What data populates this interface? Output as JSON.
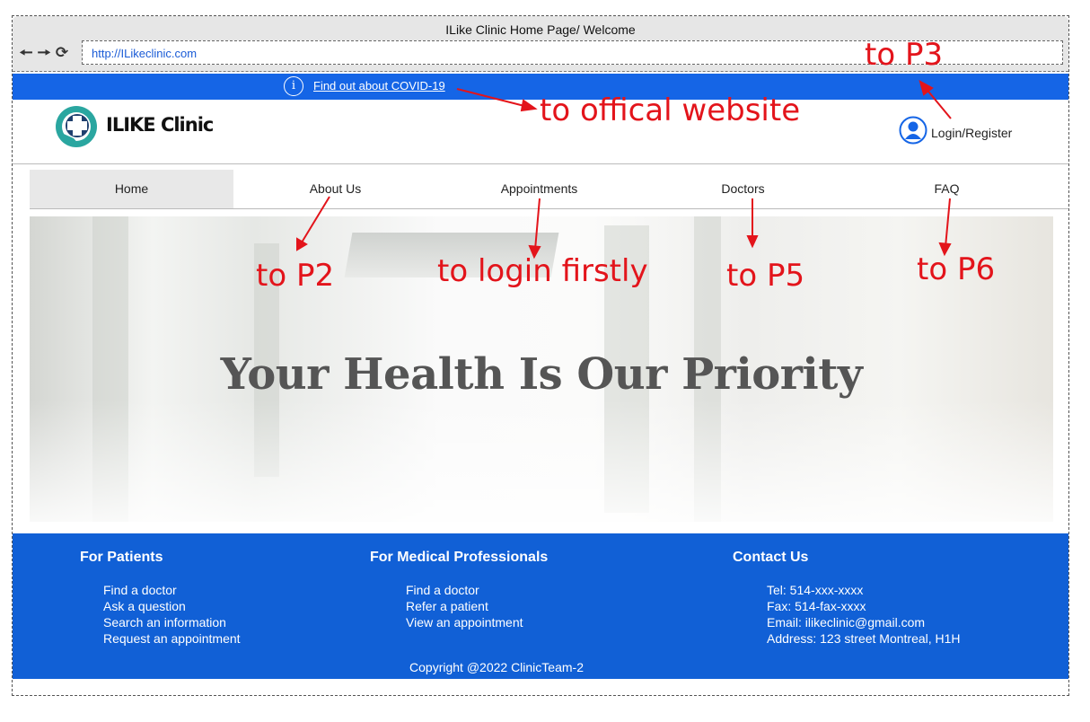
{
  "window": {
    "title": "ILike Clinic Home Page/ Welcome",
    "url": "http://ILikeclinic.com",
    "nav_icons": [
      "back-arrow-icon",
      "forward-arrow-icon",
      "refresh-icon"
    ]
  },
  "covid_bar": {
    "icon": "info-icon",
    "link": "Find out about COVID-19"
  },
  "header": {
    "logo_text": "ILIKE Clinic",
    "login": "Login/Register"
  },
  "menu": {
    "items": [
      "Home",
      "About Us",
      "Appointments",
      "Doctors",
      "FAQ"
    ],
    "active": "Home"
  },
  "hero": {
    "title": "Your Health Is Our Priority"
  },
  "footer": {
    "patients": {
      "heading": "For Patients",
      "links": [
        "Find a doctor",
        "Ask a question",
        "Search an information",
        "Request an appointment"
      ]
    },
    "professionals": {
      "heading": "For Medical Professionals",
      "links": [
        "Find a doctor",
        "Refer a patient",
        "View an appointment"
      ]
    },
    "contact": {
      "heading": "Contact Us",
      "lines": [
        "Tel: 514-xxx-xxxx",
        "Fax: 514-fax-xxxx",
        "Email: ilikeclinic@gmail.com",
        "Address: 123 street Montreal, H1H"
      ]
    },
    "copyright": "Copyright @2022 ClinicTeam-2"
  },
  "annotations": {
    "p3": "to P3",
    "official": "to offical website",
    "p2": "to P2",
    "login_first": "to login firstly",
    "p5": "to P5",
    "p6": "to P6"
  },
  "colors": {
    "brand_blue": "#1565e6",
    "footer_blue": "#1160d6",
    "annotation_red": "#e3141b",
    "logo_teal": "#2aa6a0"
  }
}
